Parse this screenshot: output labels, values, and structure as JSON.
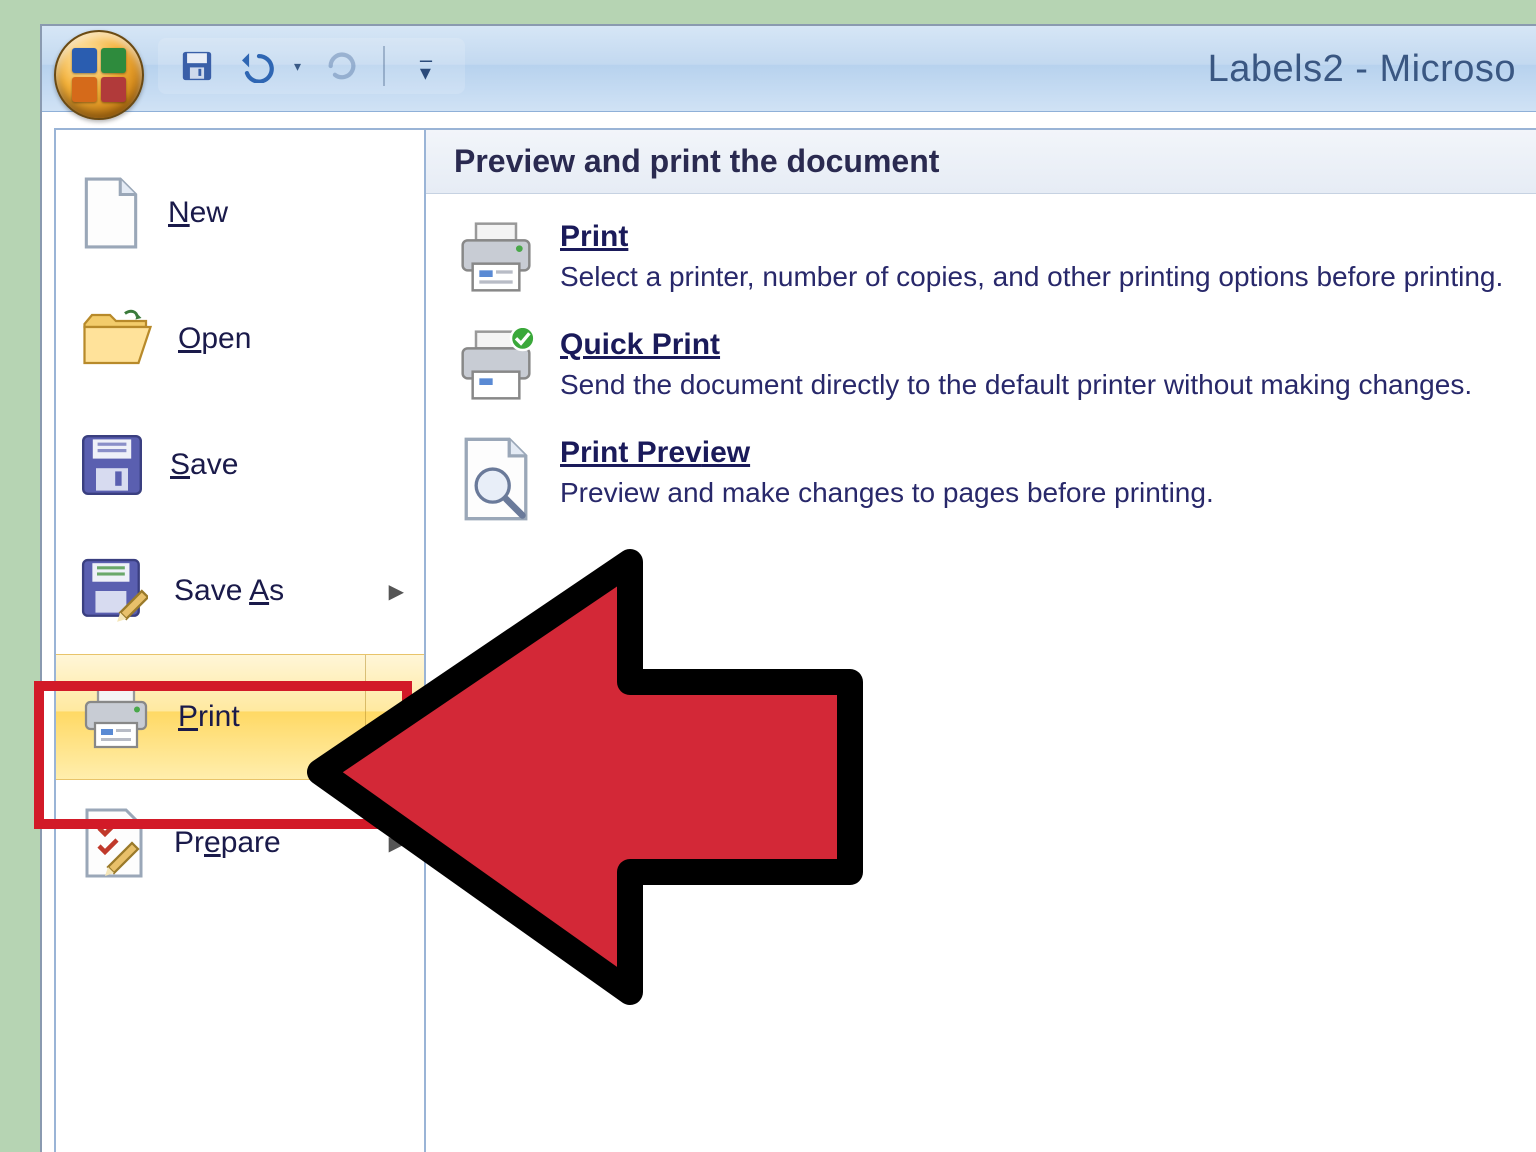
{
  "titlebar": {
    "document_title": "Labels2 - Microso"
  },
  "menu": {
    "items": [
      {
        "label_prefix": "N",
        "label_rest": "ew"
      },
      {
        "label_prefix": "O",
        "label_rest": "pen"
      },
      {
        "label_prefix": "S",
        "label_rest": "ave"
      },
      {
        "label_pre": "Save ",
        "label_prefix": "A",
        "label_rest": "s",
        "has_arrow": true
      },
      {
        "label_prefix": "P",
        "label_rest": "rint",
        "has_arrow": true,
        "selected": true
      },
      {
        "label_pre": "Pr",
        "label_prefix": "e",
        "label_rest": "pare",
        "has_arrow": true
      }
    ]
  },
  "panel": {
    "header": "Preview and print the document",
    "items": [
      {
        "title_prefix": "P",
        "title_rest": "rint",
        "desc": "Select a printer, number of copies, and other printing options before printing."
      },
      {
        "title": "Quick Print",
        "desc": "Send the document directly to the default printer without making changes."
      },
      {
        "title_pre": "Print Pre",
        "title_prefix": "v",
        "title_rest": "iew",
        "desc": "Preview and make changes to pages before printing."
      }
    ]
  }
}
